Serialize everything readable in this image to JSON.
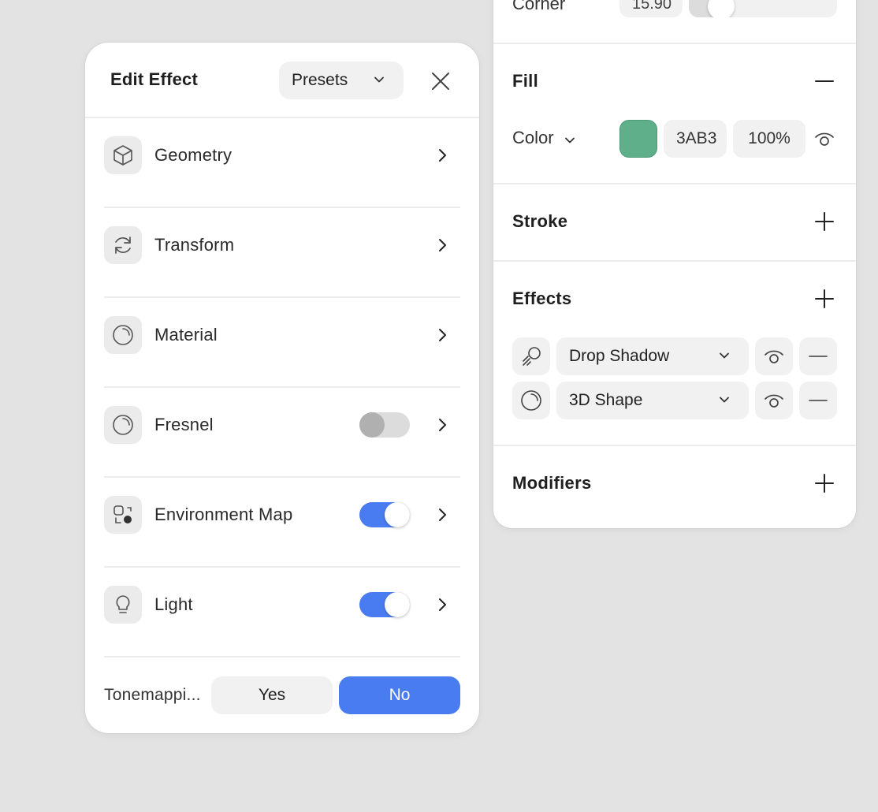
{
  "edit_effect": {
    "title": "Edit Effect",
    "presets_label": "Presets",
    "rows": [
      {
        "label": "Geometry",
        "icon": "cube-icon"
      },
      {
        "label": "Transform",
        "icon": "refresh-icon"
      },
      {
        "label": "Material",
        "icon": "sphere-icon"
      },
      {
        "label": "Fresnel",
        "icon": "sphere-icon",
        "toggle": false
      },
      {
        "label": "Environment Map",
        "icon": "environment-map-icon",
        "toggle": true
      },
      {
        "label": "Light",
        "icon": "lightbulb-icon",
        "toggle": true
      }
    ],
    "tonemapping": {
      "label": "Tonemappi...",
      "yes_label": "Yes",
      "no_label": "No",
      "selected": "No"
    }
  },
  "properties": {
    "corner": {
      "label": "Corner",
      "value": "15.90"
    },
    "fill": {
      "title": "Fill",
      "color_label": "Color",
      "swatch_color": "#5fb08a",
      "hex": "3AB3",
      "opacity": "100%"
    },
    "stroke": {
      "title": "Stroke"
    },
    "effects": {
      "title": "Effects",
      "items": [
        {
          "label": "Drop Shadow",
          "icon": "drop-shadow-icon"
        },
        {
          "label": "3D Shape",
          "icon": "sphere-icon"
        }
      ]
    },
    "modifiers": {
      "title": "Modifiers"
    }
  },
  "colors": {
    "accent": "#4a7cf1",
    "background": "#e3e3e3",
    "toggle_off": "#dcdcdc"
  }
}
